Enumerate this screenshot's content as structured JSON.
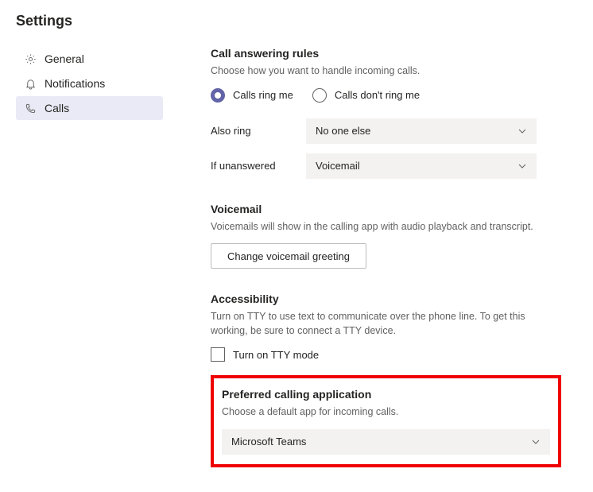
{
  "page_title": "Settings",
  "sidebar": {
    "items": [
      {
        "label": "General"
      },
      {
        "label": "Notifications"
      },
      {
        "label": "Calls"
      }
    ]
  },
  "call_rules": {
    "title": "Call answering rules",
    "desc": "Choose how you want to handle incoming calls.",
    "radio_ring_me": "Calls ring me",
    "radio_dont_ring": "Calls don't ring me",
    "also_ring_label": "Also ring",
    "also_ring_value": "No one else",
    "unanswered_label": "If unanswered",
    "unanswered_value": "Voicemail"
  },
  "voicemail": {
    "title": "Voicemail",
    "desc": "Voicemails will show in the calling app with audio playback and transcript.",
    "button": "Change voicemail greeting"
  },
  "accessibility": {
    "title": "Accessibility",
    "desc": "Turn on TTY to use text to communicate over the phone line. To get this working, be sure to connect a TTY device.",
    "checkbox_label": "Turn on TTY mode"
  },
  "preferred_app": {
    "title": "Preferred calling application",
    "desc": "Choose a default app for incoming calls.",
    "value": "Microsoft Teams"
  }
}
